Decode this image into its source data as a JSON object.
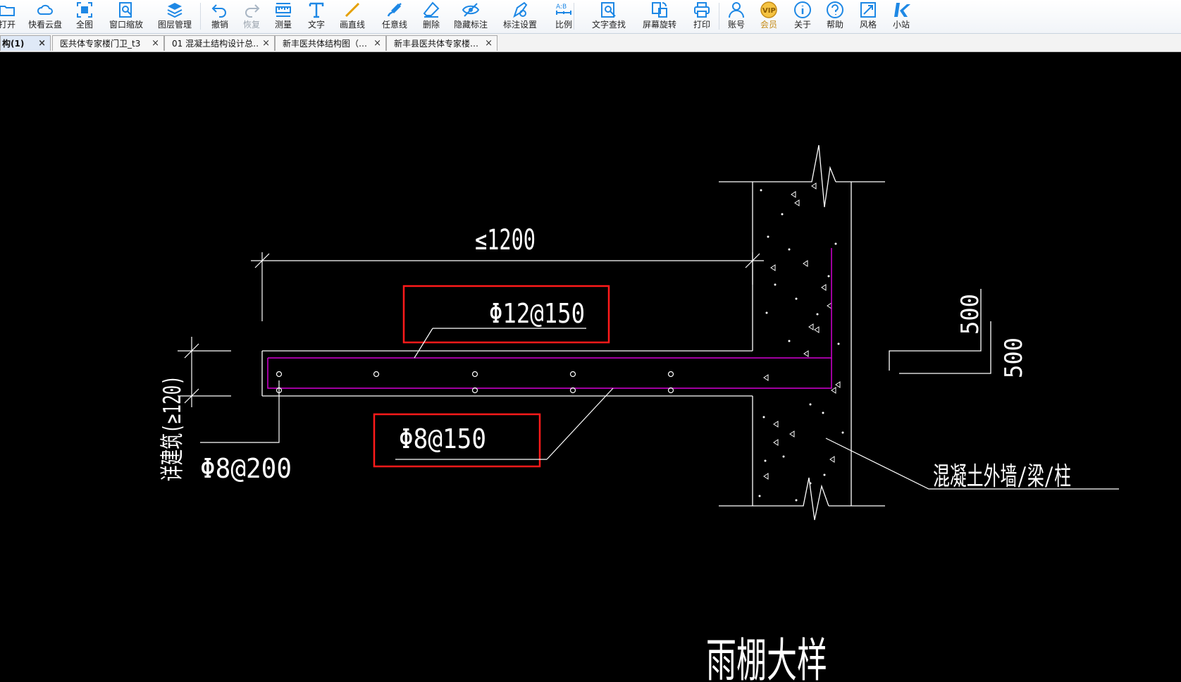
{
  "toolbar": {
    "buttons": [
      {
        "label": "打开",
        "icon": "folder-open-icon"
      },
      {
        "label": "快看云盘",
        "icon": "cloud-icon"
      },
      {
        "label": "全图",
        "icon": "fit-all-icon"
      },
      {
        "label": "窗口缩放",
        "icon": "zoom-window-icon"
      },
      {
        "label": "图层管理",
        "icon": "layers-icon"
      },
      {
        "label": "撤销",
        "icon": "undo-icon"
      },
      {
        "label": "恢复",
        "icon": "redo-icon"
      },
      {
        "label": "测量",
        "icon": "measure-icon"
      },
      {
        "label": "文字",
        "icon": "text-icon"
      },
      {
        "label": "画直线",
        "icon": "line-icon"
      },
      {
        "label": "任意线",
        "icon": "freehand-icon"
      },
      {
        "label": "删除",
        "icon": "eraser-icon"
      },
      {
        "label": "隐藏标注",
        "icon": "hide-annotation-icon"
      },
      {
        "label": "标注设置",
        "icon": "annotation-settings-icon"
      },
      {
        "label": "比例",
        "icon": "scale-icon"
      },
      {
        "label": "文字查找",
        "icon": "text-search-icon"
      },
      {
        "label": "屏幕旋转",
        "icon": "rotate-screen-icon"
      },
      {
        "label": "打印",
        "icon": "printer-icon"
      },
      {
        "label": "账号",
        "icon": "user-icon"
      },
      {
        "label": "会员",
        "icon": "vip-icon"
      },
      {
        "label": "关于",
        "icon": "info-icon"
      },
      {
        "label": "帮助",
        "icon": "help-icon"
      },
      {
        "label": "风格",
        "icon": "style-icon"
      },
      {
        "label": "小站",
        "icon": "site-logo-icon"
      }
    ]
  },
  "tabs": [
    {
      "label": "构(1)",
      "close": "×"
    },
    {
      "label": "医共体专家楼门卫_t3",
      "close": "×"
    },
    {
      "label": "01 混凝土结构设计总…",
      "close": "×"
    },
    {
      "label": "新丰医共体结构图（…",
      "close": "×"
    },
    {
      "label": "新丰县医共体专家楼…",
      "close": "×"
    }
  ],
  "drawing": {
    "span_dim": "≤1200",
    "top_rebar": "Φ12@150",
    "bottom_rebar": "Φ8@150",
    "dist_rebar": "Φ8@200",
    "thickness_note": "详建筑(≥120)",
    "dim_500_a": "500",
    "dim_500_b": "500",
    "wall_label": "混凝土外墙/梁/柱",
    "title": "雨棚大样"
  },
  "colors": {
    "rebar": "#d400d4",
    "line": "#ffffff",
    "highlight_box": "#ff1a1a",
    "canvas_bg": "#000000",
    "icon_blue": "#1e88e5",
    "vip_gold": "#c58b16"
  }
}
